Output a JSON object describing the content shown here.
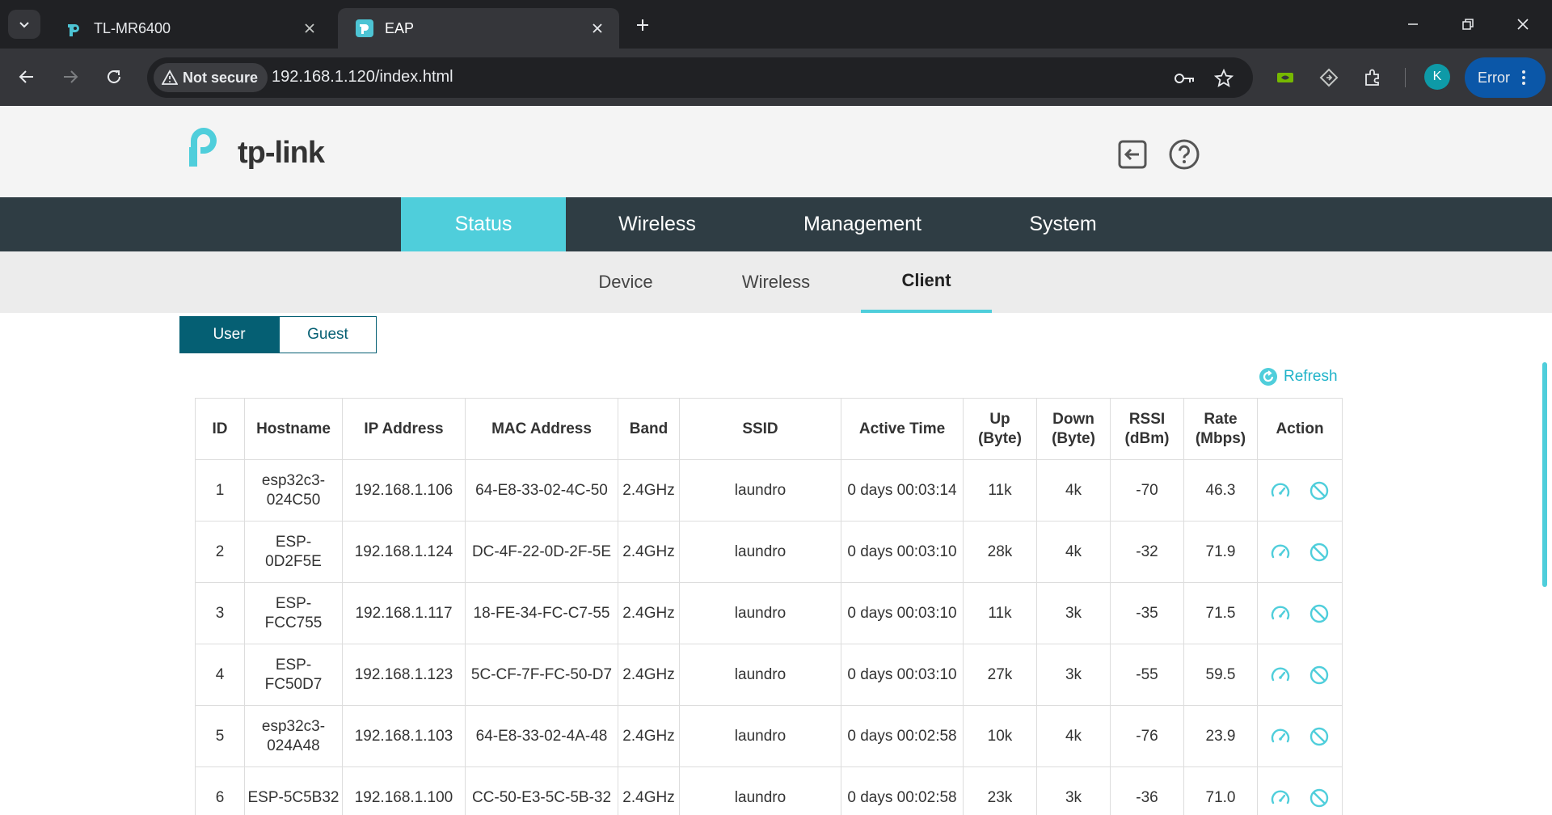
{
  "browser": {
    "tabs": [
      {
        "title": "TL-MR6400",
        "active": false
      },
      {
        "title": "EAP",
        "active": true
      }
    ],
    "security_label": "Not secure",
    "url": "192.168.1.120/index.html",
    "profile_initial": "K",
    "error_label": "Error"
  },
  "brand": {
    "logo_text": "tp-link",
    "accent": "#4fcedb",
    "dark": "#2f3d44",
    "button": "#055f73"
  },
  "main_nav": [
    {
      "label": "Status",
      "active": true
    },
    {
      "label": "Wireless",
      "active": false
    },
    {
      "label": "Management",
      "active": false
    },
    {
      "label": "System",
      "active": false
    }
  ],
  "sub_nav": [
    {
      "label": "Device",
      "active": false
    },
    {
      "label": "Wireless",
      "active": false
    },
    {
      "label": "Client",
      "active": true
    }
  ],
  "segment": {
    "user": "User",
    "guest": "Guest",
    "active": "User"
  },
  "refresh_label": "Refresh",
  "table": {
    "columns": [
      {
        "key": "id",
        "label": "ID"
      },
      {
        "key": "hostname",
        "label": "Hostname"
      },
      {
        "key": "ip",
        "label": "IP Address"
      },
      {
        "key": "mac",
        "label": "MAC Address"
      },
      {
        "key": "band",
        "label": "Band"
      },
      {
        "key": "ssid",
        "label": "SSID"
      },
      {
        "key": "active_time",
        "label": "Active Time"
      },
      {
        "key": "up",
        "label": "Up (Byte)"
      },
      {
        "key": "down",
        "label": "Down (Byte)"
      },
      {
        "key": "rssi",
        "label": "RSSI (dBm)"
      },
      {
        "key": "rate",
        "label": "Rate (Mbps)"
      },
      {
        "key": "action",
        "label": "Action"
      }
    ],
    "rows": [
      {
        "id": "1",
        "hostname": "esp32c3-024C50",
        "ip": "192.168.1.106",
        "mac": "64-E8-33-02-4C-50",
        "band": "2.4GHz",
        "ssid": "laundro",
        "active_time": "0 days 00:03:14",
        "up": "11k",
        "down": "4k",
        "rssi": "-70",
        "rate": "46.3"
      },
      {
        "id": "2",
        "hostname": "ESP-0D2F5E",
        "ip": "192.168.1.124",
        "mac": "DC-4F-22-0D-2F-5E",
        "band": "2.4GHz",
        "ssid": "laundro",
        "active_time": "0 days 00:03:10",
        "up": "28k",
        "down": "4k",
        "rssi": "-32",
        "rate": "71.9"
      },
      {
        "id": "3",
        "hostname": "ESP-FCC755",
        "ip": "192.168.1.117",
        "mac": "18-FE-34-FC-C7-55",
        "band": "2.4GHz",
        "ssid": "laundro",
        "active_time": "0 days 00:03:10",
        "up": "11k",
        "down": "3k",
        "rssi": "-35",
        "rate": "71.5"
      },
      {
        "id": "4",
        "hostname": "ESP-FC50D7",
        "ip": "192.168.1.123",
        "mac": "5C-CF-7F-FC-50-D7",
        "band": "2.4GHz",
        "ssid": "laundro",
        "active_time": "0 days 00:03:10",
        "up": "27k",
        "down": "3k",
        "rssi": "-55",
        "rate": "59.5"
      },
      {
        "id": "5",
        "hostname": "esp32c3-024A48",
        "ip": "192.168.1.103",
        "mac": "64-E8-33-02-4A-48",
        "band": "2.4GHz",
        "ssid": "laundro",
        "active_time": "0 days 00:02:58",
        "up": "10k",
        "down": "4k",
        "rssi": "-76",
        "rate": "23.9"
      },
      {
        "id": "6",
        "hostname": "ESP-5C5B32",
        "ip": "192.168.1.100",
        "mac": "CC-50-E3-5C-5B-32",
        "band": "2.4GHz",
        "ssid": "laundro",
        "active_time": "0 days 00:02:58",
        "up": "23k",
        "down": "3k",
        "rssi": "-36",
        "rate": "71.0"
      }
    ]
  }
}
